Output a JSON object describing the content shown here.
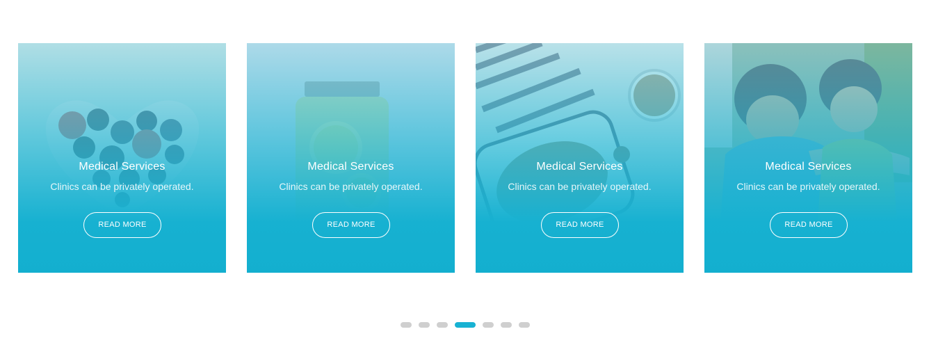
{
  "cards": [
    {
      "title": "Medical Services",
      "description": "Clinics can be privately operated.",
      "button": "READ MORE",
      "image": "berries-heart-bowl"
    },
    {
      "title": "Medical Services",
      "description": "Clinics can be privately operated.",
      "button": "READ MORE",
      "image": "lemon-water-jar"
    },
    {
      "title": "Medical Services",
      "description": "Clinics can be privately operated.",
      "button": "READ MORE",
      "image": "oats-and-coffee"
    },
    {
      "title": "Medical Services",
      "description": "Clinics can be privately operated.",
      "button": "READ MORE",
      "image": "children-playing"
    }
  ],
  "pagination": {
    "count": 7,
    "active_index": 3
  },
  "colors": {
    "accent": "#18b2d3",
    "dot_inactive": "#cfcfcf",
    "overlay_bottom": "#13afcf"
  }
}
